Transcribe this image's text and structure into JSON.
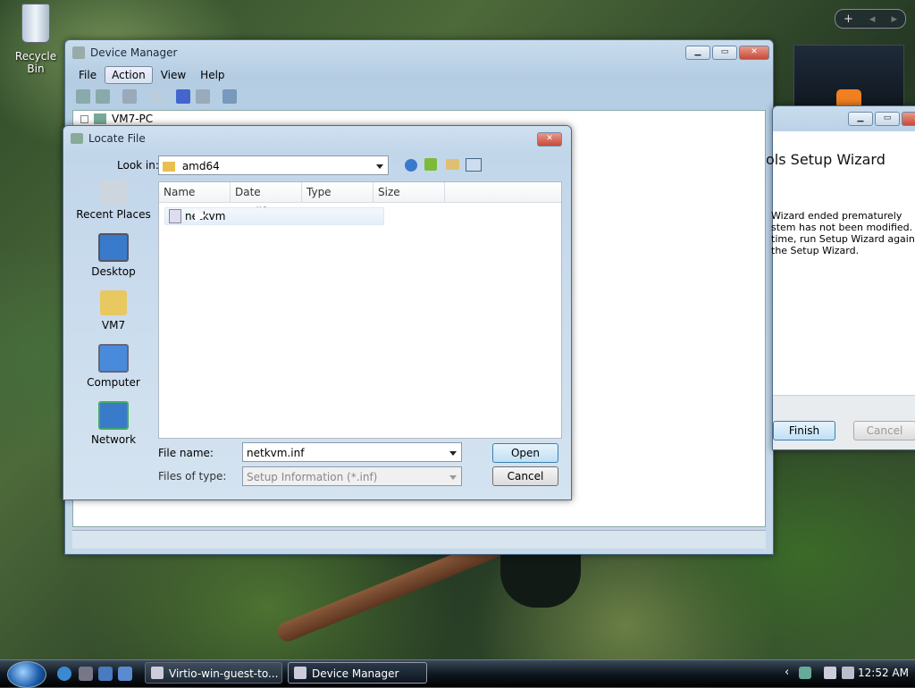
{
  "desktop": {
    "recycle_bin_label": "Recycle Bin"
  },
  "device_manager": {
    "title": "Device Manager",
    "menus": [
      "File",
      "Action",
      "View",
      "Help"
    ],
    "tree_root": "VM7-PC"
  },
  "wizard": {
    "title_partial": "ols Setup Wizard",
    "body_lines": [
      "Wizard ended prematurely",
      "stem has not been modified. To",
      "time, run Setup Wizard again.",
      "the Setup Wizard."
    ],
    "finish_label": "Finish",
    "cancel_label": "Cancel"
  },
  "locate_file": {
    "title": "Locate File",
    "look_in_label": "Look in:",
    "look_in_value": "amd64",
    "places": [
      {
        "label": "Recent Places",
        "icon": "recent-places-icon"
      },
      {
        "label": "Desktop",
        "icon": "desktop-icon"
      },
      {
        "label": "VM7",
        "icon": "user-folder-icon"
      },
      {
        "label": "Computer",
        "icon": "computer-icon"
      },
      {
        "label": "Network",
        "icon": "network-icon"
      }
    ],
    "columns": [
      "Name",
      "Date modif...",
      "Type",
      "Size"
    ],
    "files": [
      {
        "name": "netkvm",
        "icon": "setup-info-file-icon"
      }
    ],
    "file_name_label": "File name:",
    "file_name_value": "netkvm.inf",
    "files_of_type_label": "Files of type:",
    "files_of_type_value": "Setup Information (*.inf)",
    "open_label": "Open",
    "cancel_label": "Cancel"
  },
  "taskbar": {
    "tasks": [
      "Virtio-win-guest-to...",
      "Device Manager"
    ],
    "clock": "12:52 AM"
  },
  "colors": {
    "title_bar": "#c9dced",
    "accent": "#3c7fb1",
    "taskbar": "#101820"
  }
}
